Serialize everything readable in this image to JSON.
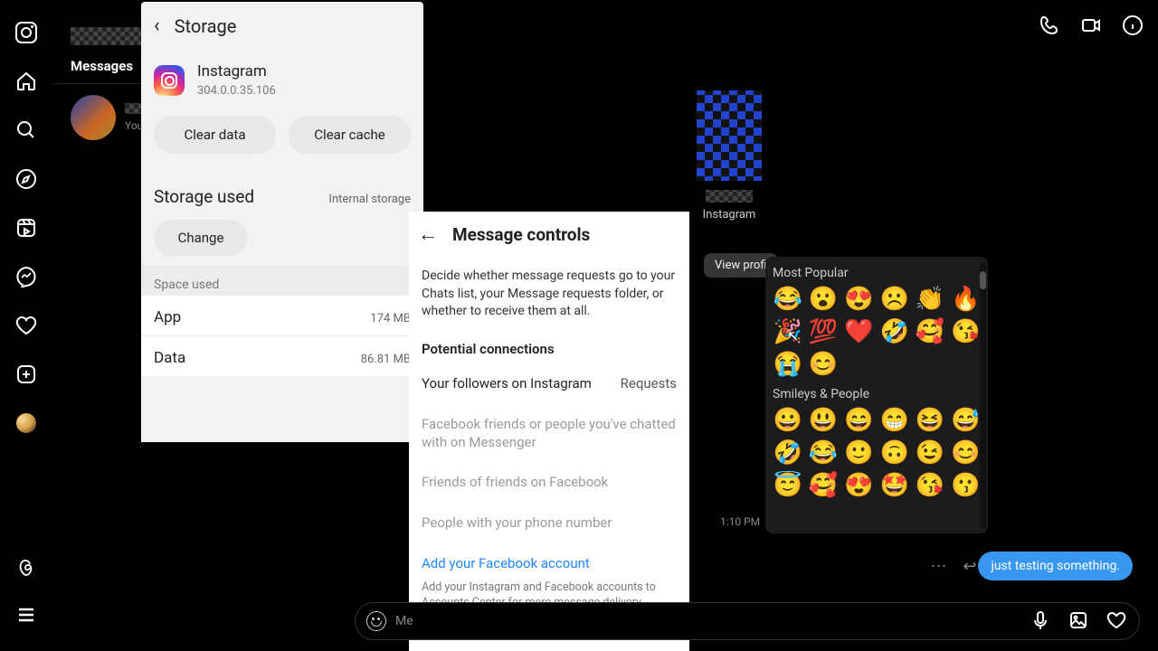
{
  "sidebar": {},
  "messages": {
    "tab": "Messages",
    "preview_prefix": "You: j"
  },
  "chat": {
    "subtitle": "Instagram",
    "view_profile": "View profi",
    "timestamp": "1:10 PM",
    "bubble": "just testing something.",
    "composer_placeholder": "Me"
  },
  "storage": {
    "title": "Storage",
    "app_name": "Instagram",
    "app_version": "304.0.0.35.106",
    "clear_data": "Clear data",
    "clear_cache": "Clear cache",
    "used_label": "Storage used",
    "used_location": "Internal storage",
    "change": "Change",
    "space_used": "Space used",
    "rows": [
      {
        "label": "App",
        "value": "174 MB"
      },
      {
        "label": "Data",
        "value": "86.81 MB"
      }
    ]
  },
  "message_controls": {
    "title": "Message controls",
    "desc": "Decide whether message requests go to your Chats list, your Message requests folder, or whether to receive them at all.",
    "potential": "Potential connections",
    "row1_label": "Your followers on Instagram",
    "row1_value": "Requests",
    "item2": "Facebook friends or people you've chatted with on Messenger",
    "item3": "Friends of friends on Facebook",
    "item4": "People with your phone number",
    "link": "Add your Facebook account",
    "footer": "Add your Instagram and Facebook accounts to Accounts Center for more message delivery options."
  },
  "emoji": {
    "sect1": "Most Popular",
    "sect2": "Smileys & People",
    "popular": [
      "😂",
      "😮",
      "😍",
      "☹️",
      "👏",
      "🔥",
      "🎉",
      "💯",
      "❤️",
      "🤣",
      "🥰",
      "😘",
      "😭",
      "😊"
    ],
    "smileys": [
      "😀",
      "😃",
      "😄",
      "😁",
      "😆",
      "😅",
      "🤣",
      "😂",
      "🙂",
      "🙃",
      "😉",
      "😊",
      "😇",
      "🥰",
      "😍",
      "🤩",
      "😘",
      "😗"
    ]
  }
}
